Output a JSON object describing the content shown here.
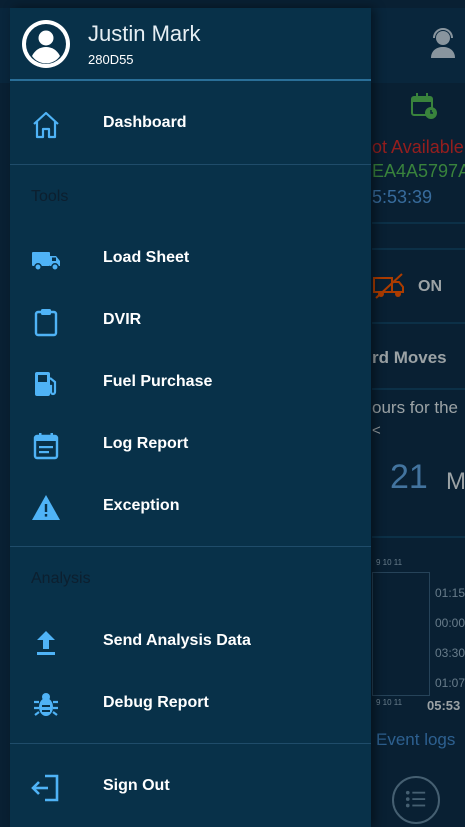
{
  "background": {
    "status_not_available": "ot Available",
    "status_id": "EA4A5797A",
    "status_time": "5:53:39",
    "duty_toggle": "ON",
    "moves_label": "rd Moves",
    "hours_label": "ours for the",
    "hours_caret": "<",
    "counter_value": "21",
    "counter_unit": "M",
    "ticks_top": "9  10  11",
    "ticks_bottom": "9  10  11",
    "log_times": [
      "01:15",
      "00:00",
      "03:30",
      "01:07"
    ],
    "log_total": "05:53",
    "event_logs": "Event logs"
  },
  "user": {
    "name": "Justin Mark",
    "code": "280D55"
  },
  "menu": {
    "dashboard": "Dashboard",
    "tools_title": "Tools",
    "load_sheet": "Load Sheet",
    "dvir": "DVIR",
    "fuel_purchase": "Fuel Purchase",
    "log_report": "Log Report",
    "exception": "Exception",
    "analysis_title": "Analysis",
    "send_analysis": "Send Analysis Data",
    "debug_report": "Debug Report",
    "sign_out": "Sign Out"
  },
  "colors": {
    "accent_icon": "#4fb3f6",
    "drawer_bg": "#083149",
    "header_rule": "#2a6f98",
    "section_title": "#0c1f2f"
  },
  "icons": {
    "dashboard": "home-icon",
    "load_sheet": "truck-icon",
    "dvir": "clipboard-icon",
    "fuel_purchase": "fuel-pump-icon",
    "log_report": "calendar-report-icon",
    "exception": "warning-icon",
    "send_analysis": "upload-icon",
    "debug_report": "bug-icon",
    "sign_out": "exit-icon"
  }
}
